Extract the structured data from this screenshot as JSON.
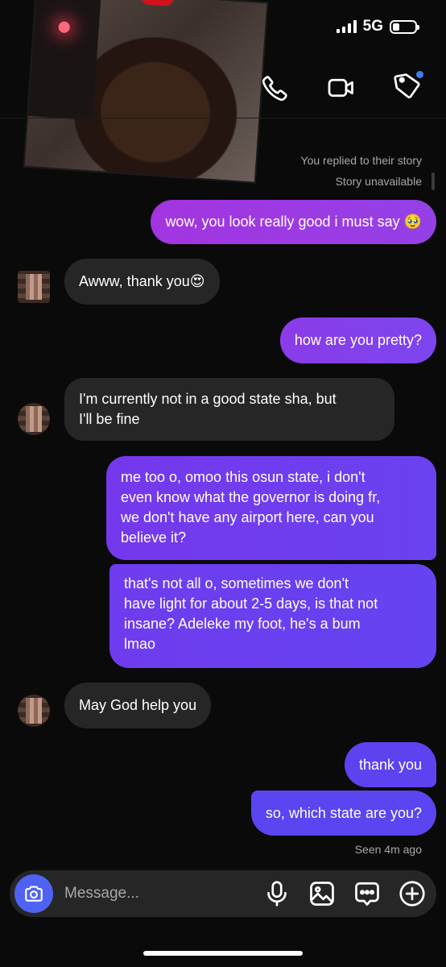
{
  "status_bar": {
    "network": "5G",
    "signal_bars": 4,
    "battery_level": 0.3
  },
  "header": {
    "actions": [
      {
        "name": "voice-call",
        "icon": "phone-icon"
      },
      {
        "name": "video-call",
        "icon": "video-camera-icon"
      },
      {
        "name": "tag",
        "icon": "tag-icon",
        "has_notification_dot": true
      }
    ]
  },
  "story_reply": {
    "caption": "You replied to their story",
    "status": "Story unavailable"
  },
  "messages": [
    {
      "from": "me",
      "text": "wow, you look really good i must say 🥹"
    },
    {
      "from": "them",
      "text": "Awww, thank you😍"
    },
    {
      "from": "me",
      "text": "how are you pretty?"
    },
    {
      "from": "them",
      "lines": [
        "I'm currently not in a good state sha, but",
        "I'll be fine"
      ]
    },
    {
      "from": "me",
      "lines": [
        "me too o, omoo this osun state, i don't",
        "even know what the governor is doing fr,",
        "we don't have any airport here, can you",
        "believe it?"
      ]
    },
    {
      "from": "me",
      "lines": [
        "that's not all o, sometimes we don't",
        "have light for about 2-5 days, is that not",
        "insane? Adeleke my foot, he's a bum",
        "lmao"
      ]
    },
    {
      "from": "them",
      "text": "May God help you"
    },
    {
      "from": "me",
      "text": "thank you"
    },
    {
      "from": "me",
      "text": "so, which state are you?"
    }
  ],
  "seen_status": "Seen 4m ago",
  "composer": {
    "placeholder": "Message...",
    "actions": [
      "microphone-icon",
      "image-icon",
      "chat-options-icon",
      "add-icon"
    ]
  },
  "colors": {
    "background": "#0a0a0a",
    "incoming_bubble": "#262626",
    "outgoing_gradient_start": "#a335e0",
    "outgoing_gradient_end": "#5a45f1",
    "camera_button": "#4f62f4",
    "secondary_text": "#a8a8a8"
  }
}
